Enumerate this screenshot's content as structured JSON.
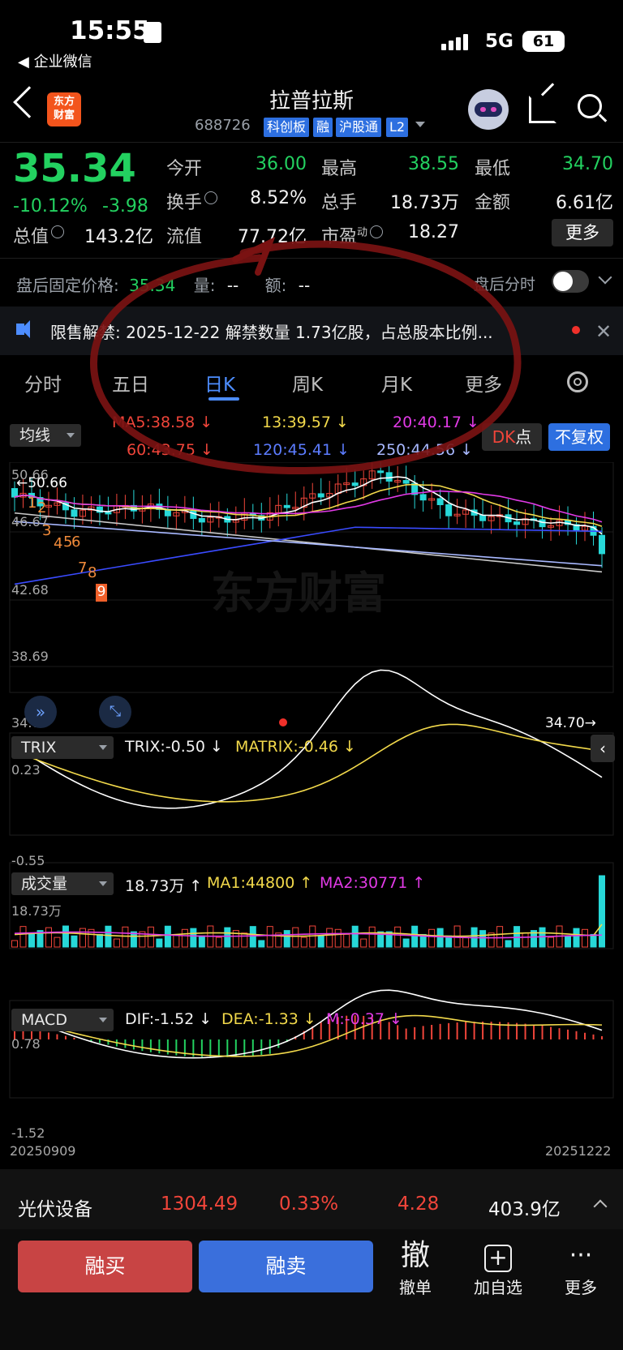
{
  "status_bar": {
    "time": "15:55",
    "back_app": "◀ 企业微信",
    "network": "5G",
    "battery": "61"
  },
  "header": {
    "logo_line1": "东方",
    "logo_line2": "财富",
    "stock_name": "拉普拉斯",
    "stock_code": "688726",
    "tags": [
      "科创板",
      "融",
      "沪股通",
      "L2"
    ]
  },
  "quote": {
    "price": "35.34",
    "change_pct": "-10.12%",
    "change_amt": "-3.98",
    "fields": {
      "open_label": "今开",
      "open": "36.00",
      "high_label": "最高",
      "high": "38.55",
      "low_label": "最低",
      "low": "34.70",
      "turnover_label": "换手",
      "turnover": "8.52%",
      "volume_label": "总手",
      "volume": "18.73万",
      "amount_label": "金额",
      "amount": "6.61亿",
      "mktcap_label": "总值",
      "mktcap": "143.2亿",
      "float_label": "流值",
      "float": "77.72亿",
      "pe_label": "市盈",
      "pe_sup": "动",
      "pe": "18.27"
    },
    "more_button": "更多"
  },
  "after_hours": {
    "price_label": "盘后固定价格:",
    "price": "35.34",
    "vol_label": "量:",
    "vol": "--",
    "amt_label": "额:",
    "amt": "--",
    "timeshare_label": "盘后分时"
  },
  "notice": {
    "label": "限售解禁:",
    "text": "2025-12-22 解禁数量 1.73亿股，占总股本比例..."
  },
  "tabs": [
    {
      "label": "分时",
      "active": false
    },
    {
      "label": "五日",
      "active": false
    },
    {
      "label": "日K",
      "active": true
    },
    {
      "label": "周K",
      "active": false
    },
    {
      "label": "月K",
      "active": false
    },
    {
      "label": "更多",
      "active": false
    }
  ],
  "ma": {
    "selector": "均线",
    "ma5": "MA5:38.58 ↓",
    "ma13": "13:39.57 ↓",
    "ma20": "20:40.17 ↓",
    "ma60": "60:43.75 ↓",
    "ma120": "120:45.41 ↓",
    "ma250": "250:44.56 ↓",
    "dk_label_red": "DK",
    "dk_label_white": "点",
    "adjust_button": "不复权"
  },
  "kline_axis": {
    "y_top": "50.66",
    "y2": "46.67",
    "y3": "42.68",
    "y4": "38.69",
    "y_bottom": "34.70",
    "max_marker": "←50.66",
    "min_marker": "34.70→"
  },
  "kline_markers": [
    "1",
    "2",
    "3",
    "4",
    "5",
    "6",
    "7",
    "8",
    "9"
  ],
  "trix": {
    "selector": "TRIX",
    "trix": "TRIX:-0.50 ↓",
    "matrix": "MATRIX:-0.46 ↓",
    "y_top": "0.23",
    "y_bottom": "-0.55"
  },
  "volume": {
    "selector": "成交量",
    "value": "18.73万 ↑",
    "ma1": "MA1:44800 ↑",
    "ma2": "MA2:30771 ↑",
    "y_top": "18.73万"
  },
  "macd": {
    "selector": "MACD",
    "dif": "DIF:-1.52 ↓",
    "dea": "DEA:-1.33 ↓",
    "m": "M:-0.37 ↓",
    "y_top": "0.78",
    "y_bottom": "-1.52",
    "date_start": "20250909",
    "date_end": "20251222"
  },
  "sector": {
    "name": "光伏设备",
    "value": "1304.49",
    "pct": "0.33%",
    "chg": "4.28",
    "amount": "403.9亿"
  },
  "bottom": {
    "buy": "融买",
    "sell": "融卖",
    "cancel_icon": "撤",
    "cancel": "撤单",
    "add": "加自选",
    "more": "更多"
  },
  "colors": {
    "up": "#f0453a",
    "down": "#23d160",
    "accent": "#4d8dff",
    "candle_down": "#27d8d8"
  }
}
